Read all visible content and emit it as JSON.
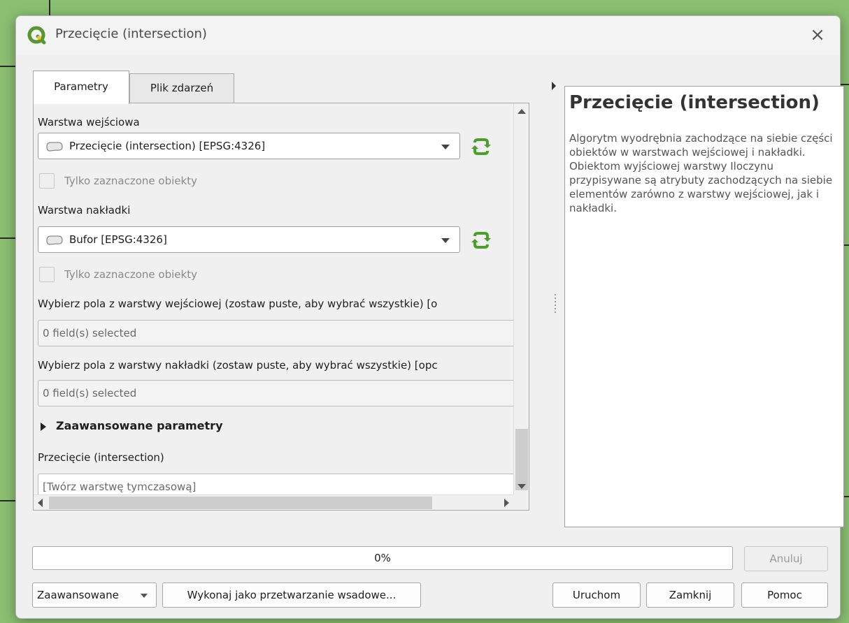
{
  "window": {
    "title": "Przecięcie (intersection)",
    "close_glyph": "×",
    "icon": "qgis-logo-icon"
  },
  "tabs": [
    {
      "label": "Parametry",
      "active": true
    },
    {
      "label": "Plik zdarzeń",
      "active": false
    }
  ],
  "params": {
    "input_layer_label": "Warstwa wejściowa",
    "input_layer_value": "Przecięcie (intersection) [EPSG:4326]",
    "input_selected_only": "Tylko zaznaczone obiekty",
    "overlay_layer_label": "Warstwa nakładki",
    "overlay_layer_value": "Bufor [EPSG:4326]",
    "overlay_selected_only": "Tylko zaznaczone obiekty",
    "input_fields_label": "Wybierz pola z warstwy wejściowej (zostaw puste, aby wybrać wszystkie) [o",
    "input_fields_value": "0 field(s) selected",
    "overlay_fields_label": "Wybierz pola z warstwy nakładki (zostaw puste, aby wybrać wszystkie) [opc",
    "overlay_fields_value": "0 field(s) selected",
    "advanced_label": "Zaawansowane parametry",
    "output_label": "Przecięcie (intersection)",
    "output_value": "[Twórz warstwę tymczasową]"
  },
  "help": {
    "title": "Przecięcie (intersection)",
    "text": "Algorytm wyodrębnia zachodzące na siebie części obiektów w warstwach wejściowej i nakładki. Obiektom wyjściowej warstwy Iloczynu przypisywane są atrybuty zachodzących na siebie elementów zarówno z warstwy wejściowej, jak i nakładki."
  },
  "progress": {
    "value": 0,
    "label": "0%"
  },
  "buttons": {
    "cancel": "Anuluj",
    "advanced": "Zaawansowane",
    "batch": "Wykonaj jako przetwarzanie wsadowe...",
    "run": "Uruchom",
    "close": "Zamknij",
    "help": "Pomoc"
  },
  "colors": {
    "qgis_green": "#589632",
    "qgis_yellow": "#f0c81e",
    "refresh_green": "#4aa02c"
  }
}
